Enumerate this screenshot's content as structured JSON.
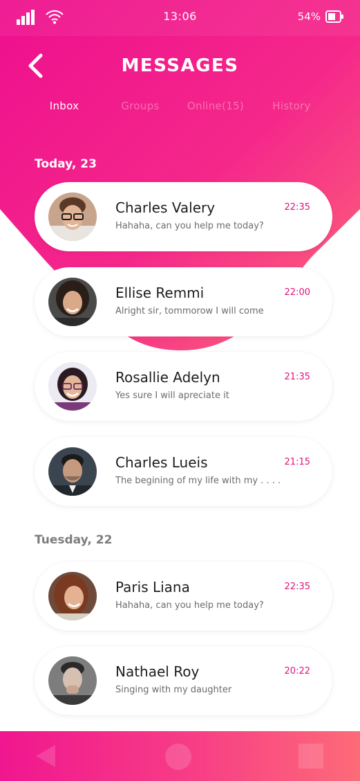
{
  "status_bar": {
    "time": "13:06",
    "battery": "54%",
    "icons": [
      "signal-icon",
      "wifi-icon",
      "battery-icon"
    ]
  },
  "header": {
    "title": "MESSAGES",
    "back_icon": "chevron-left-icon"
  },
  "tabs": [
    {
      "label": "Inbox",
      "active": true
    },
    {
      "label": "Groups",
      "active": false
    },
    {
      "label": "Online(15)",
      "active": false
    },
    {
      "label": "History",
      "active": false
    }
  ],
  "sections": [
    {
      "label": "Today, 23",
      "conversations": [
        {
          "name": "Charles Valery",
          "time": "22:35",
          "preview": "Hahaha, can you help me today?"
        },
        {
          "name": "Ellise Remmi",
          "time": "22:00",
          "preview": "Alright sir, tommorow I will come"
        },
        {
          "name": "Rosallie Adelyn",
          "time": "21:35",
          "preview": "Yes sure I will apreciate it"
        },
        {
          "name": "Charles Lueis",
          "time": "21:15",
          "preview": "The begining of my life with my . . . ."
        }
      ]
    },
    {
      "label": "Tuesday, 22",
      "conversations": [
        {
          "name": "Paris Liana",
          "time": "22:35",
          "preview": "Hahaha, can you help me today?"
        },
        {
          "name": "Nathael Roy",
          "time": "20:22",
          "preview": "Singing with my daughter"
        }
      ]
    }
  ],
  "nav_bar": {
    "icons": [
      "back-triangle-icon",
      "home-circle-icon",
      "recent-square-icon"
    ]
  },
  "colors": {
    "accent": "#e0117e",
    "gradient_start": "#ee0f8e",
    "gradient_end": "#fd6b78",
    "text_dark": "#1d1d1d",
    "text_muted": "#6b6b6b"
  }
}
